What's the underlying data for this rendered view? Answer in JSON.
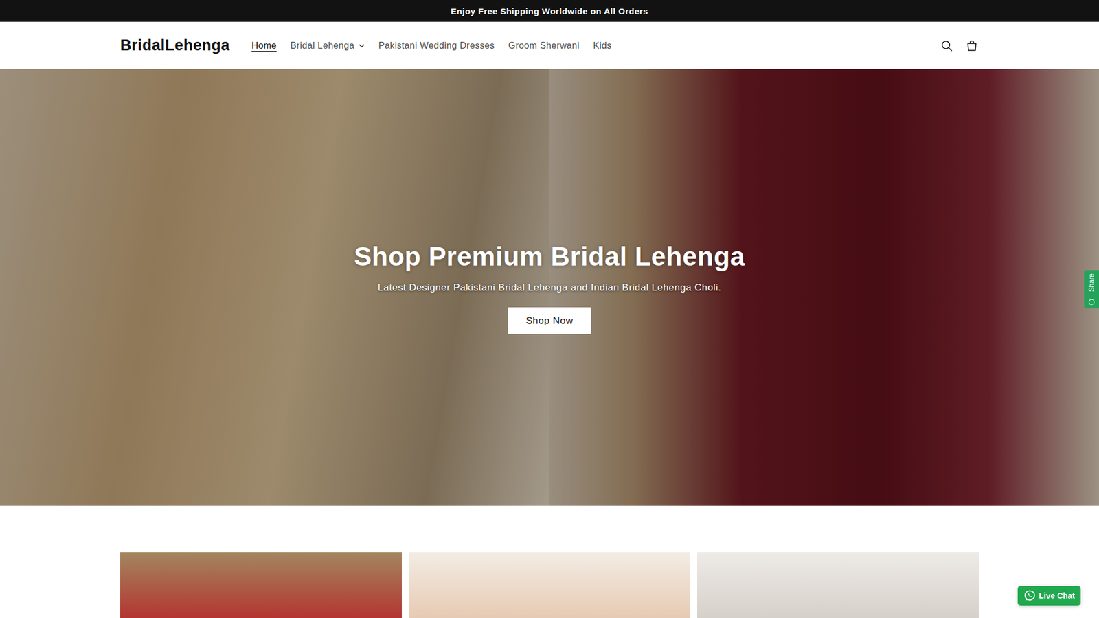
{
  "announcement": "Enjoy Free Shipping Worldwide on All Orders",
  "header": {
    "logo": "BridalLehenga",
    "nav": [
      {
        "label": "Home",
        "selected": true,
        "kind": "link"
      },
      {
        "label": "Bridal Lehenga",
        "selected": false,
        "kind": "dropdown"
      },
      {
        "label": "Pakistani Wedding Dresses",
        "selected": false,
        "kind": "link"
      },
      {
        "label": "Groom Sherwani",
        "selected": false,
        "kind": "link"
      },
      {
        "label": "Kids",
        "selected": false,
        "kind": "link"
      }
    ]
  },
  "hero": {
    "heading": "Shop Premium Bridal Lehenga",
    "subheading": "Latest Designer Pakistani Bridal Lehenga and Indian Bridal Lehenga Choli.",
    "button": "Shop Now"
  },
  "floating": {
    "share": "Share",
    "live_chat": "Live Chat"
  }
}
